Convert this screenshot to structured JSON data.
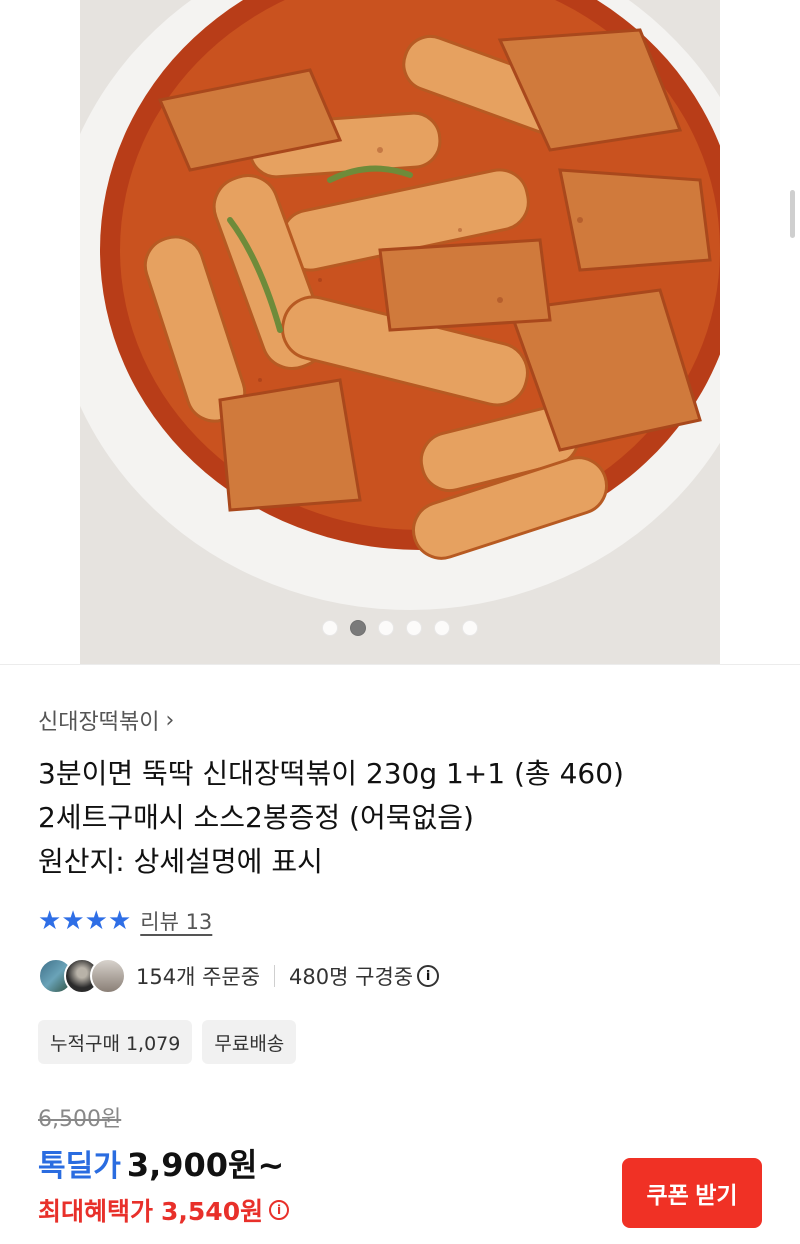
{
  "gallery": {
    "image_alt": "Tteokbokki in a white bowl",
    "dot_count": 6,
    "active_index": 1
  },
  "product": {
    "category": "신대장떡볶이",
    "category_chevron": "chevron-right-icon",
    "title_lines": [
      "3분이면 뚝딱 신대장떡볶이 230g 1+1 (총 460)",
      "2세트구매시 소스2봉증정 (어묵없음)",
      "원산지: 상세설명에 표시"
    ],
    "rating_stars": 4,
    "review_label": "리뷰 13",
    "buyers_label": "154개 주문중",
    "viewers_label": "480명 구경중",
    "badges": [
      "누적구매 1,079",
      "무료배송"
    ]
  },
  "pricing": {
    "original_price": "6,500원",
    "sale_label": "톡딜가",
    "sale_price": "3,900원~",
    "max_label": "최대혜택가",
    "max_price": "3,540원"
  },
  "actions": {
    "coupon_button": "쿠폰 받기"
  },
  "colors": {
    "accent_blue": "#2a6ce0",
    "star_blue": "#2e6ee6",
    "accent_red": "#e8302a",
    "button_red": "#f03125"
  }
}
